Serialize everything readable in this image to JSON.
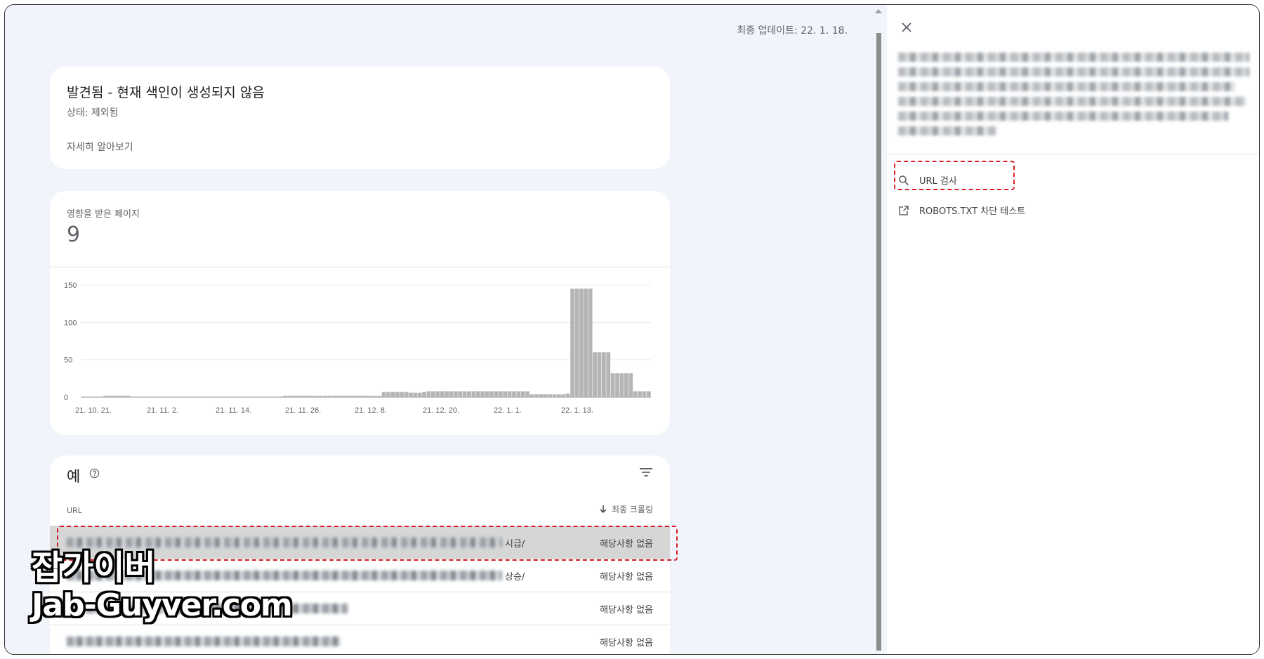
{
  "header": {
    "last_update": "최종 업데이트: 22. 1. 18."
  },
  "status_card": {
    "title": "발견됨 - 현재 색인이 생성되지 않음",
    "subtitle": "상태: 제외됨",
    "learn_more": "자세히 알아보기"
  },
  "chart_card": {
    "label": "영향을 받은 페이지",
    "count": "9"
  },
  "chart_data": {
    "type": "bar",
    "ylim": [
      0,
      150
    ],
    "y_ticks": [
      "150",
      "100",
      "50",
      "0"
    ],
    "x_tick_labels": [
      "21. 10. 21.",
      "21. 11. 2.",
      "21. 11. 14.",
      "21. 11. 26.",
      "21. 12. 8.",
      "21. 12. 20.",
      "22. 1. 1.",
      "22. 1. 13."
    ],
    "values": [
      1,
      1,
      1,
      1,
      1,
      2,
      2,
      2,
      2,
      2,
      2,
      1,
      1,
      1,
      1,
      1,
      1,
      1,
      1,
      1,
      1,
      1,
      1,
      1,
      1,
      1,
      1,
      1,
      1,
      1,
      1,
      1,
      1,
      1,
      1,
      1,
      1,
      1,
      1,
      1,
      1,
      1,
      1,
      1,
      1,
      2,
      2,
      2,
      2,
      2,
      2,
      2,
      2,
      2,
      2,
      2,
      2,
      2,
      2,
      2,
      2,
      2,
      2,
      2,
      2,
      2,
      2,
      7,
      7,
      7,
      7,
      7,
      7,
      6,
      6,
      6,
      7,
      8,
      8,
      8,
      8,
      8,
      8,
      8,
      8,
      8,
      8,
      8,
      8,
      8,
      8,
      8,
      8,
      8,
      8,
      8,
      8,
      8,
      8,
      8,
      4,
      4,
      4,
      4,
      4,
      4,
      4,
      4,
      5,
      145,
      145,
      145,
      145,
      145,
      60,
      60,
      60,
      60,
      32,
      32,
      32,
      32,
      32,
      8,
      8,
      8,
      8
    ],
    "grid": true
  },
  "examples": {
    "title": "예",
    "col_url": "URL",
    "col_crawl": "최종 크롤링",
    "rows": [
      {
        "url_suffix": "시급/",
        "crawl": "해당사항 없음"
      },
      {
        "url_suffix": "상승/",
        "crawl": "해당사항 없음"
      },
      {
        "url_suffix": "",
        "crawl": "해당사항 없음"
      },
      {
        "url_suffix": "",
        "crawl": "해당사항 없음"
      }
    ]
  },
  "panel": {
    "url_inspect": "URL 검사",
    "robots_test": "ROBOTS.TXT 차단 테스트"
  },
  "watermark": {
    "line1": "잡가이버",
    "line2": "Jab-Guyver.com"
  }
}
